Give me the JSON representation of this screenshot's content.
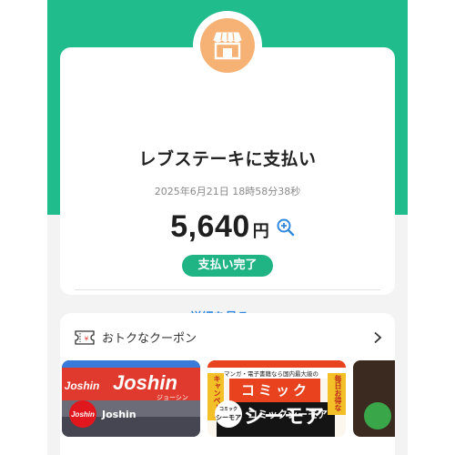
{
  "payment": {
    "title": "レブステーキに支払い",
    "timestamp": "2025年6月21日 18時58分38秒",
    "amount": "5,640",
    "currency": "円",
    "status": "支払い完了",
    "details_link": "詳細を見る"
  },
  "coupons": {
    "header": "おトクなクーポン",
    "cards": [
      {
        "store_name": "Joshin",
        "logo_text": "Joshin",
        "sign_text": "Joshin",
        "sign_subtext": "ジョーシン"
      },
      {
        "store_name": "コミックシーモア",
        "logo_text": "シーモア",
        "logo_small": "コミック",
        "banner_top": "マンガ・電子書籍なら国内最大級の",
        "banner_main": "コミック",
        "banner_big": "シーモア",
        "side_tag_left": "キャンペーン",
        "side_tag_right": "毎日お得な"
      }
    ]
  },
  "colors": {
    "header_green": "#21bc8c",
    "status_green": "#20b484",
    "link_blue": "#2f88dd",
    "store_icon_orange": "#f6b174"
  },
  "icons": [
    "store-icon",
    "zoom-in-icon",
    "chevron-down-icon",
    "ticket-icon",
    "chevron-right-icon"
  ]
}
